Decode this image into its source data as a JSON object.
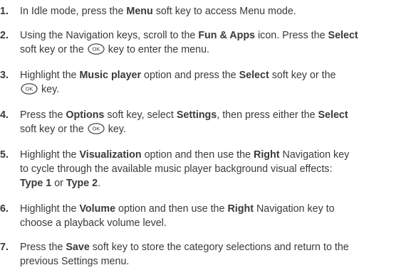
{
  "steps": [
    {
      "number": "1.",
      "lines": [
        [
          {
            "t": "In Idle mode, press the "
          },
          {
            "t": "Menu",
            "b": true
          },
          {
            "t": " soft key to access Menu mode."
          }
        ]
      ]
    },
    {
      "number": "2.",
      "lines": [
        [
          {
            "t": "Using the Navigation keys, scroll to the "
          },
          {
            "t": "Fun & Apps",
            "b": true
          },
          {
            "t": " icon. Press the "
          },
          {
            "t": "Select",
            "b": true
          }
        ],
        [
          {
            "t": "soft key or the "
          },
          {
            "icon": "ok-key-icon",
            "label": "OK"
          },
          {
            "t": " key to enter the menu."
          }
        ]
      ]
    },
    {
      "number": "3.",
      "lines": [
        [
          {
            "t": "Highlight the "
          },
          {
            "t": "Music player",
            "b": true
          },
          {
            "t": " option and press the "
          },
          {
            "t": "Select",
            "b": true
          },
          {
            "t": " soft key or the"
          }
        ],
        [
          {
            "icon": "ok-key-icon",
            "label": "OK"
          },
          {
            "t": " key."
          }
        ]
      ]
    },
    {
      "number": "4.",
      "lines": [
        [
          {
            "t": "Press the "
          },
          {
            "t": "Options",
            "b": true
          },
          {
            "t": " soft key, select "
          },
          {
            "t": "Settings",
            "b": true
          },
          {
            "t": ", then press either the "
          },
          {
            "t": "Select",
            "b": true
          }
        ],
        [
          {
            "t": "soft key or the "
          },
          {
            "icon": "ok-key-icon",
            "label": "OK"
          },
          {
            "t": " key."
          }
        ]
      ]
    },
    {
      "number": "5.",
      "lines": [
        [
          {
            "t": "Highlight the "
          },
          {
            "t": "Visualization",
            "b": true
          },
          {
            "t": " option and then use the "
          },
          {
            "t": "Right",
            "b": true
          },
          {
            "t": " Navigation key"
          }
        ],
        [
          {
            "t": "to cycle through the available music player background visual effects:"
          }
        ],
        [
          {
            "t": "Type 1",
            "b": true
          },
          {
            "t": " or "
          },
          {
            "t": "Type 2",
            "b": true
          },
          {
            "t": "."
          }
        ]
      ]
    },
    {
      "number": "6.",
      "lines": [
        [
          {
            "t": "Highlight the "
          },
          {
            "t": "Volume",
            "b": true
          },
          {
            "t": " option and then use the "
          },
          {
            "t": "Right",
            "b": true
          },
          {
            "t": " Navigation key to"
          }
        ],
        [
          {
            "t": "choose a playback volume level."
          }
        ]
      ]
    },
    {
      "number": "7.",
      "lines": [
        [
          {
            "t": "Press the "
          },
          {
            "t": "Save",
            "b": true
          },
          {
            "t": " soft key to store the category selections and return to the"
          }
        ],
        [
          {
            "t": "previous Settings menu."
          }
        ]
      ]
    }
  ]
}
